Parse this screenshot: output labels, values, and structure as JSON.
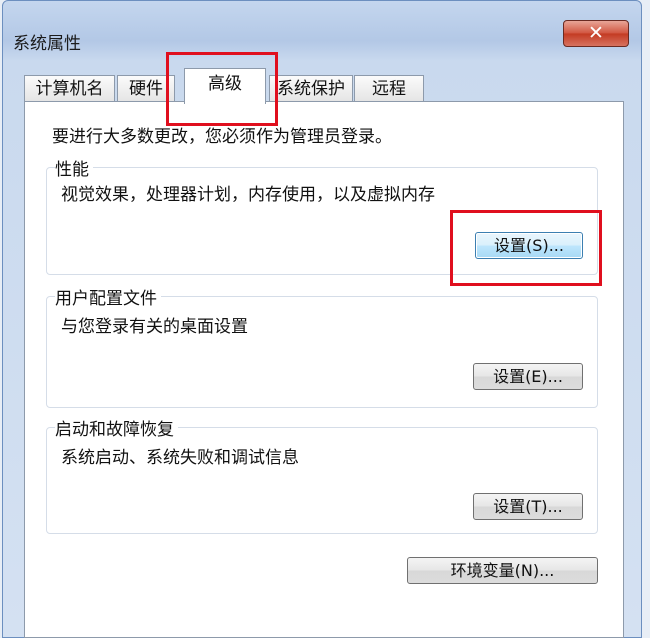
{
  "window": {
    "title": "系统属性",
    "close_glyph": "✕"
  },
  "tabs": [
    {
      "label": "计算机名"
    },
    {
      "label": "硬件"
    },
    {
      "label": "高级"
    },
    {
      "label": "系统保护"
    },
    {
      "label": "远程"
    }
  ],
  "active_tab": "高级",
  "admin_note": "要进行大多数更改，您必须作为管理员登录。",
  "performance": {
    "label": "性能",
    "description": "视觉效果，处理器计划，内存使用，以及虚拟内存",
    "button": "设置(S)..."
  },
  "user_profiles": {
    "label": "用户配置文件",
    "description": "与您登录有关的桌面设置",
    "button": "设置(E)..."
  },
  "startup_recovery": {
    "label": "启动和故障恢复",
    "description": "系统启动、系统失败和调试信息",
    "button": "设置(T)..."
  },
  "env_button": "环境变量(N)...",
  "colors": {
    "highlight": "#e00f1e",
    "window_frame": "#c4d6ee"
  }
}
